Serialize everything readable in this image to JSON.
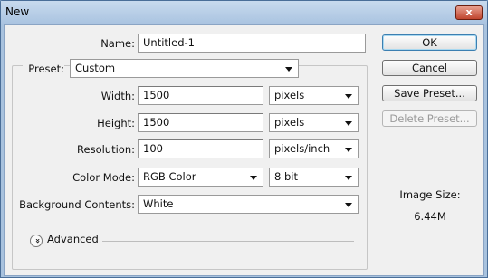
{
  "window": {
    "title": "New",
    "close_label": "x"
  },
  "name": {
    "label": "Name:",
    "value": "Untitled-1"
  },
  "preset": {
    "label": "Preset:",
    "value": "Custom"
  },
  "width": {
    "label": "Width:",
    "value": "1500",
    "unit": "pixels"
  },
  "height": {
    "label": "Height:",
    "value": "1500",
    "unit": "pixels"
  },
  "resolution": {
    "label": "Resolution:",
    "value": "100",
    "unit": "pixels/inch"
  },
  "color_mode": {
    "label": "Color Mode:",
    "value": "RGB Color",
    "depth": "8 bit"
  },
  "background": {
    "label": "Background Contents:",
    "value": "White"
  },
  "advanced": {
    "label": "Advanced",
    "icon": "chevron-double-down-icon",
    "glyph": "»"
  },
  "buttons": {
    "ok": "OK",
    "cancel": "Cancel",
    "save_preset": "Save Preset...",
    "delete_preset": "Delete Preset..."
  },
  "image_size": {
    "label": "Image Size:",
    "value": "6.44M"
  },
  "colors": {
    "titlebar": "#a9c3e0",
    "default_button_border": "#3c7fb1",
    "dialog_bg": "#f0f0f0"
  }
}
